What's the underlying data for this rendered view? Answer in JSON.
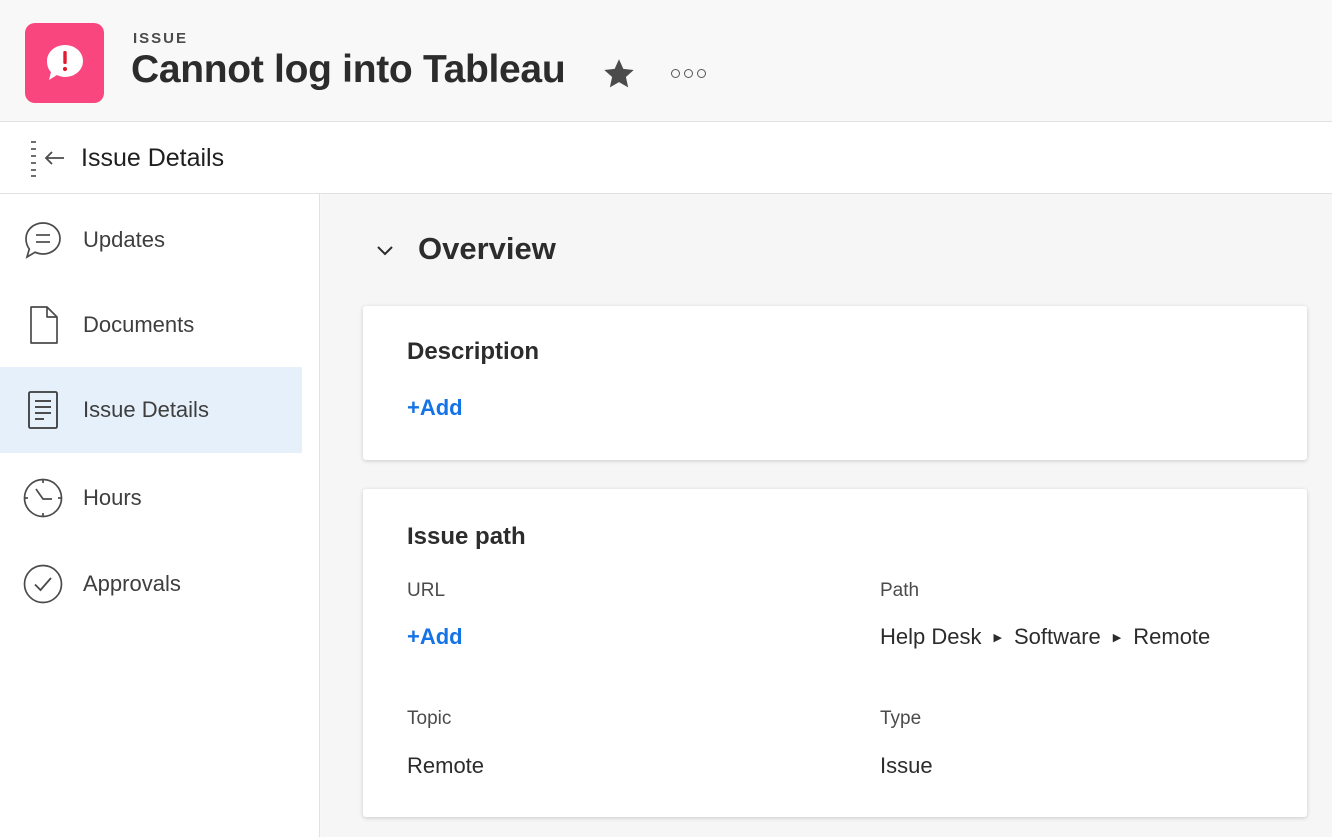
{
  "header": {
    "object_type": "ISSUE",
    "title": "Cannot log into Tableau",
    "app_icon": "issue-speech-bubble-icon",
    "app_icon_color": "#f9467e",
    "favorite_icon": "star-icon",
    "more_icon": "more-icon"
  },
  "subheader": {
    "title": "Issue Details",
    "collapse_icon": "collapse-panel-icon"
  },
  "sidebar": {
    "items": [
      {
        "label": "Updates",
        "icon": "chat-bubble-icon",
        "active": false
      },
      {
        "label": "Documents",
        "icon": "document-icon",
        "active": false
      },
      {
        "label": "Issue Details",
        "icon": "details-icon",
        "active": true
      },
      {
        "label": "Hours",
        "icon": "clock-icon",
        "active": false
      },
      {
        "label": "Approvals",
        "icon": "check-circle-icon",
        "active": false
      }
    ]
  },
  "main": {
    "section_title": "Overview",
    "description_card": {
      "title": "Description",
      "add_label": "+Add"
    },
    "issue_path_card": {
      "title": "Issue path",
      "url_label": "URL",
      "url_add_label": "+Add",
      "path_label": "Path",
      "path_segments": [
        "Help Desk",
        "Software",
        "Remote"
      ],
      "topic_label": "Topic",
      "topic_value": "Remote",
      "type_label": "Type",
      "type_value": "Issue"
    }
  },
  "colors": {
    "link": "#1473e6",
    "active_nav_bg": "#e5f0fb"
  }
}
